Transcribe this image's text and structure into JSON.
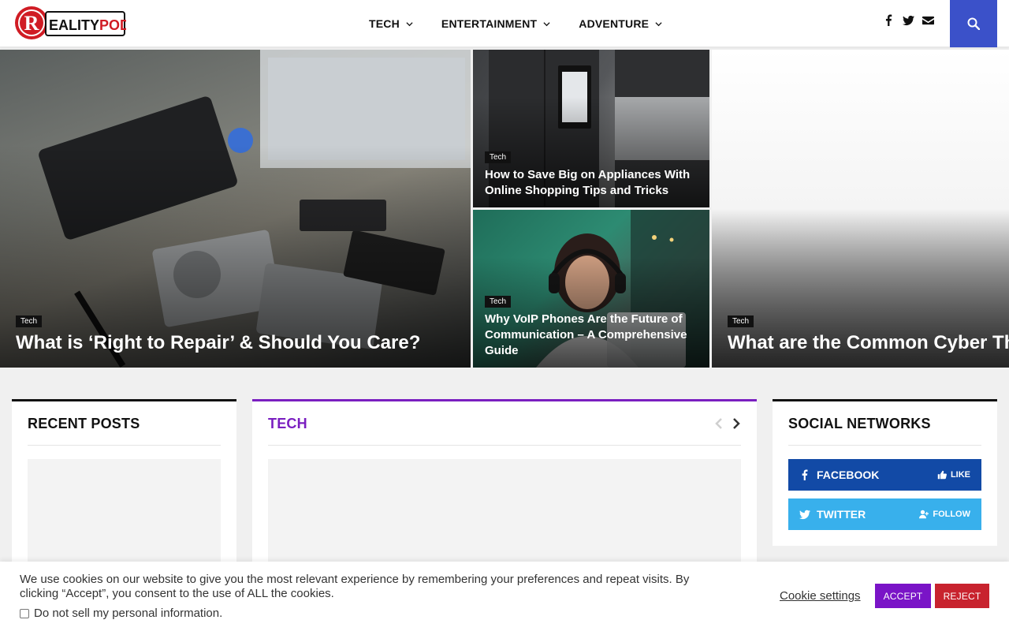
{
  "header": {
    "logo_text": "REALITYPOD",
    "nav": [
      {
        "label": "TECH"
      },
      {
        "label": "ENTERTAINMENT"
      },
      {
        "label": "ADVENTURE"
      }
    ],
    "social_icons": [
      "facebook-icon",
      "twitter-icon",
      "envelope-icon"
    ],
    "search_icon": "search-icon",
    "accent": "#3b51c9"
  },
  "hero": {
    "main": {
      "tag": "Tech",
      "title": "What is ‘Right to Repair’ & Should You Care?"
    },
    "top_right": {
      "tag": "Tech",
      "title": "How to Save Big on Appliances With Online Shopping Tips and Tricks"
    },
    "bottom_right": {
      "tag": "Tech",
      "title": "Why VoIP Phones Are the Future of Communication – A Comprehensive Guide"
    },
    "far_right": {
      "tag": "Tech",
      "title": "What are the Common Cyber Thre"
    }
  },
  "widgets": {
    "recent": {
      "title": "RECENT POSTS"
    },
    "tech": {
      "title": "TECH",
      "accent": "#7a1fc0"
    },
    "social": {
      "title": "SOCIAL NETWORKS",
      "facebook": {
        "label": "FACEBOOK",
        "action": "LIKE",
        "color": "#124aa6"
      },
      "twitter": {
        "label": "TWITTER",
        "action": "FOLLOW",
        "color": "#38b0ec"
      }
    }
  },
  "cookie": {
    "text": "We use cookies on our website to give you the most relevant experience by remembering your preferences and repeat visits. By clicking “Accept”, you consent to the use of ALL the cookies.",
    "checkbox_label": "Do not sell my personal information.",
    "settings": "Cookie settings",
    "accept": "ACCEPT",
    "reject": "REJECT"
  }
}
